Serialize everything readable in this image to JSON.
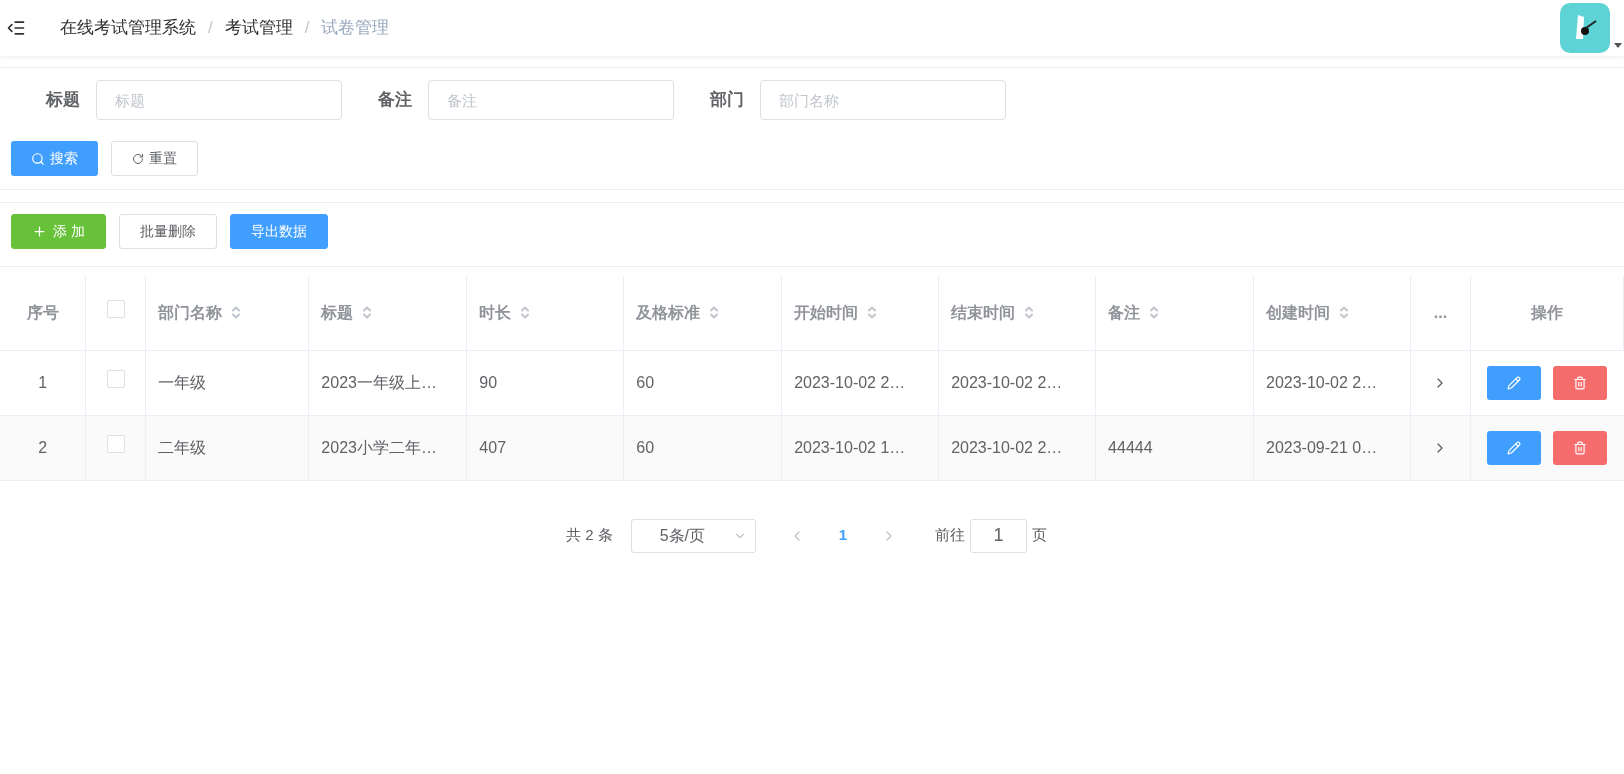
{
  "breadcrumb": [
    {
      "label": "在线考试管理系统",
      "current": false
    },
    {
      "label": "考试管理",
      "current": false
    },
    {
      "label": "试卷管理",
      "current": true
    }
  ],
  "breadcrumb_separator": "/",
  "filters": [
    {
      "label": "标题",
      "placeholder": "标题"
    },
    {
      "label": "备注",
      "placeholder": "备注"
    },
    {
      "label": "部门",
      "placeholder": "部门名称"
    }
  ],
  "search_button": "搜索",
  "reset_button": "重置",
  "toolbar": [
    {
      "label": "添 加",
      "kind": "add"
    },
    {
      "label": "批量删除",
      "kind": "plain"
    },
    {
      "label": "导出数据",
      "kind": "primary"
    }
  ],
  "table": {
    "columns": [
      {
        "label": "序号",
        "kind": "index"
      },
      {
        "kind": "check",
        "checked": false
      },
      {
        "label": "部门名称",
        "kind": "sort"
      },
      {
        "label": "标题",
        "kind": "sort"
      },
      {
        "label": "时长",
        "kind": "sort"
      },
      {
        "label": "及格标准",
        "kind": "sort"
      },
      {
        "label": "开始时间",
        "kind": "sort"
      },
      {
        "label": "结束时间",
        "kind": "sort"
      },
      {
        "label": "备注",
        "kind": "sort"
      },
      {
        "label": "创建时间",
        "kind": "sort"
      },
      {
        "label": "...",
        "kind": "more"
      },
      {
        "label": "操作",
        "kind": "actions"
      }
    ],
    "rows": [
      {
        "checked": false,
        "cells": [
          "1",
          "",
          "一年级",
          "2023一年级上…",
          "90",
          "60",
          "2023-10-02 2…",
          "2023-10-02 2…",
          "",
          "2023-10-02 2…"
        ]
      },
      {
        "checked": false,
        "cells": [
          "2",
          "",
          "二年级",
          "2023小学二年…",
          "407",
          "60",
          "2023-10-02 1…",
          "2023-10-02 2…",
          "44444",
          "2023-09-21 0…"
        ]
      }
    ]
  },
  "pagination": {
    "total": "共 2 条",
    "page_size": "5条/页",
    "pages": [
      {
        "label": "1",
        "selected": true
      }
    ],
    "goto_label": "前往",
    "goto_value": "1",
    "goto_suffix": "页"
  }
}
